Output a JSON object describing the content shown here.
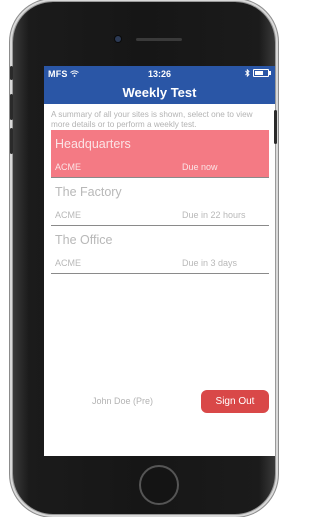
{
  "status_bar": {
    "carrier": "MFS",
    "wifi_icon": "wifi-icon",
    "time": "13:26",
    "bluetooth_icon": "bluetooth-icon",
    "battery_icon": "battery-icon"
  },
  "header": {
    "title": "Weekly Test"
  },
  "description": "A summary of all your sites is shown, select one to view more details or to perform a weekly test.",
  "sites": [
    {
      "name": "Headquarters",
      "org": "ACME",
      "due": "Due now",
      "highlighted": true
    },
    {
      "name": "The Factory",
      "org": "ACME",
      "due": "Due in 22 hours",
      "highlighted": false
    },
    {
      "name": "The Office",
      "org": "ACME",
      "due": "Due in 3 days",
      "highlighted": false
    }
  ],
  "footer": {
    "user": "John Doe (Pre)",
    "sign_out_label": "Sign Out"
  },
  "colors": {
    "accent": "#2a56a6",
    "due_highlight": "#f47a84",
    "sign_out": "#d94848"
  }
}
